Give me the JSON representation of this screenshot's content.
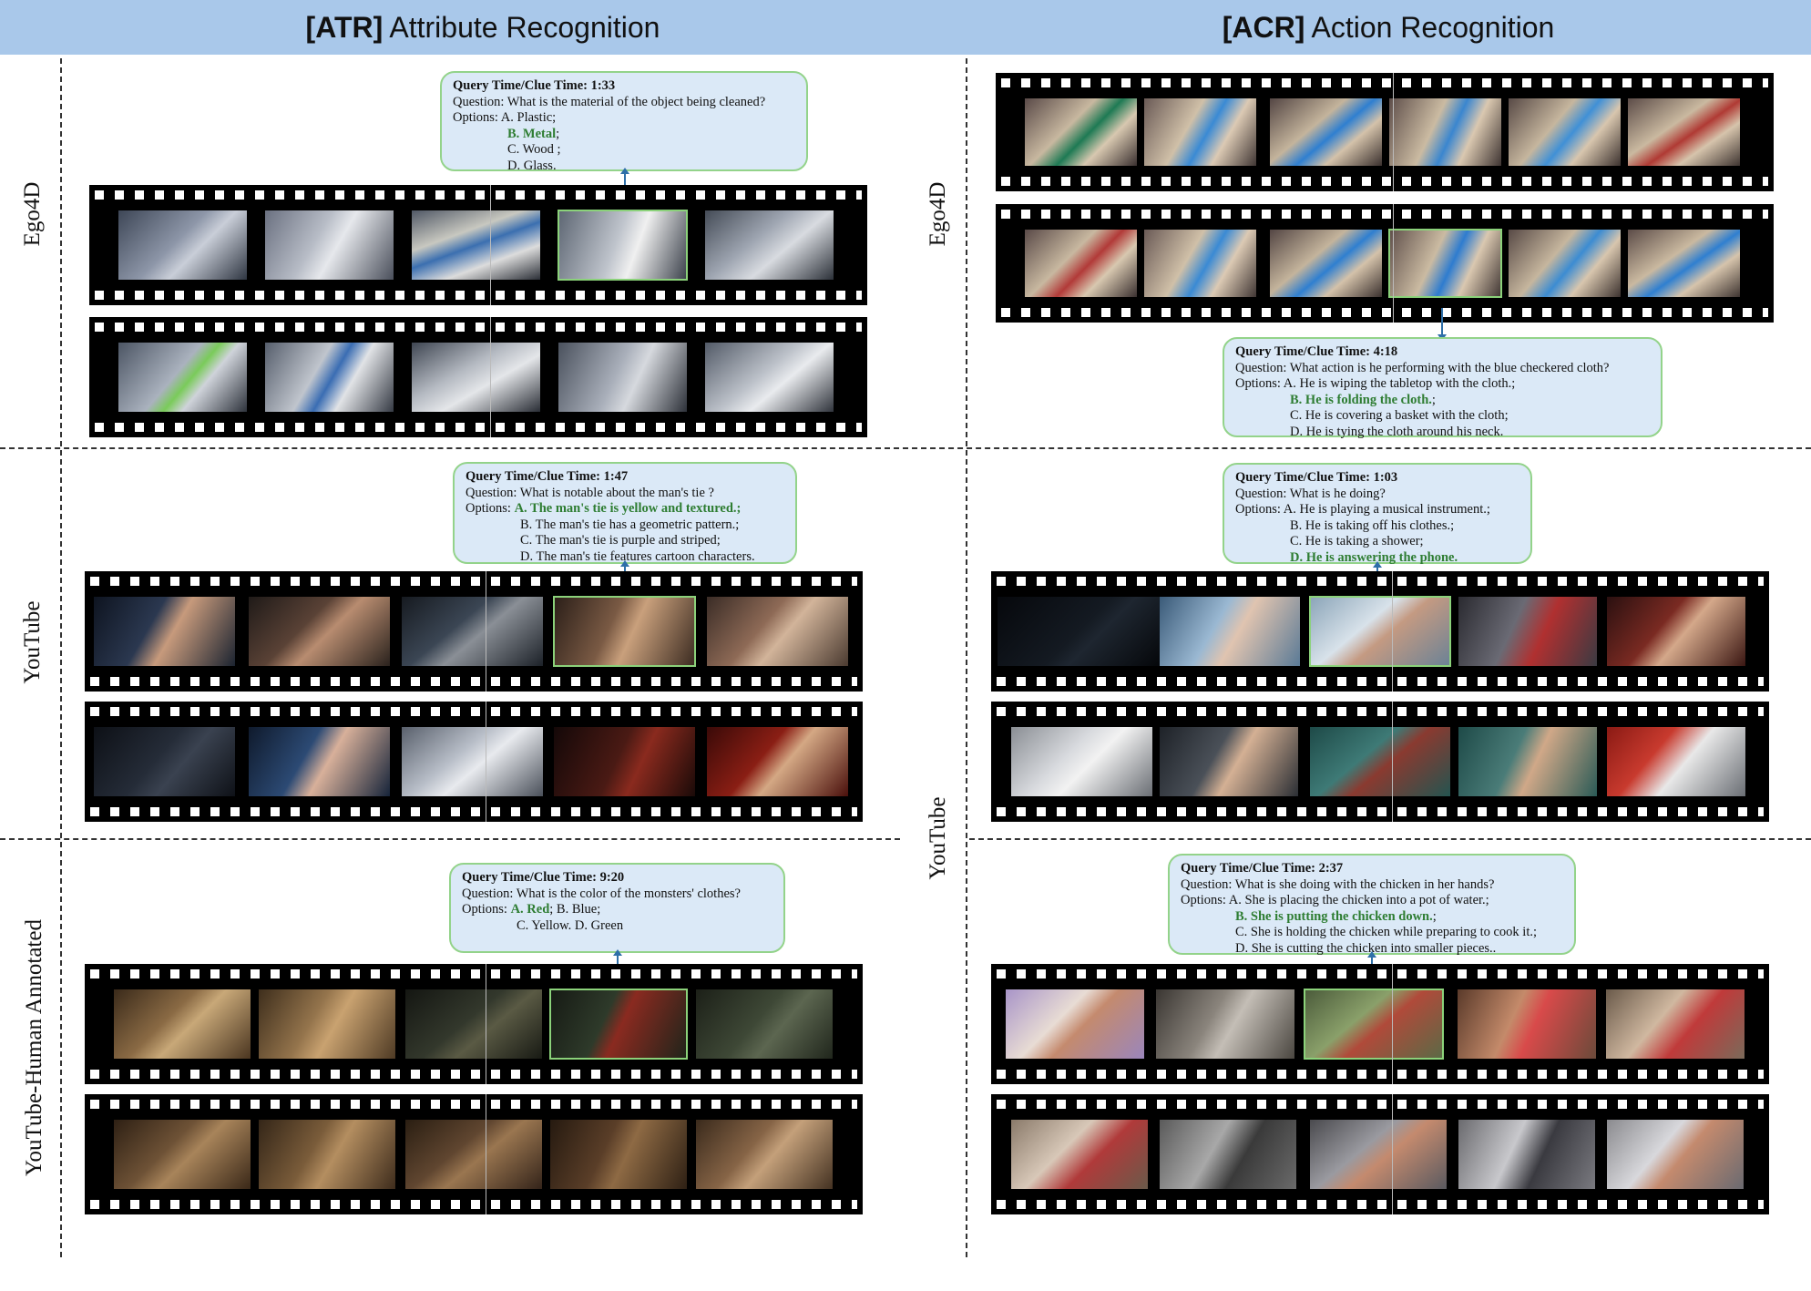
{
  "header": {
    "left": {
      "tag": "[ATR]",
      "title": "Attribute Recognition"
    },
    "right": {
      "tag": "[ACR]",
      "title": "Action Recognition"
    }
  },
  "row_labels": {
    "atr_ego4d": "Ego4D",
    "atr_youtube": "YouTube",
    "atr_human": "YouTube-Human Annotated",
    "acr_ego4d": "Ego4D",
    "acr_youtube": "YouTube"
  },
  "colors": {
    "header_bg": "#a9c8ea",
    "box_bg": "#dbe9f7",
    "box_border": "#93d38a",
    "correct_text": "#2e7d32",
    "arrow": "#2e6fa8"
  },
  "boxes": {
    "atr_ego4d": {
      "time_label": "Query Time/Clue Time: 1:33",
      "question": "Question: What is the material of the object being cleaned?",
      "opts_prefix": "Options: ",
      "opt_a": "A. Plastic;",
      "opt_b": "B. Metal",
      "opt_b_suffix": ";",
      "opt_c": "C. Wood ;",
      "opt_d": "D. Glass."
    },
    "atr_youtube": {
      "time_label": "Query Time/Clue Time: 1:47",
      "question": "Question: What is notable about the man's tie ?",
      "opts_prefix": "Options: ",
      "opt_a": "A. The man's tie is yellow and textured.;",
      "opt_b": "B. The man's tie has a geometric pattern.;",
      "opt_c": "C. The man's tie is purple and striped;",
      "opt_d": "D. The man's tie features cartoon characters."
    },
    "atr_human": {
      "time_label": "Query Time/Clue Time: 9:20",
      "question": "Question: What is the color of the monsters' clothes?",
      "opts_prefix": "Options: ",
      "opt_a": "A. Red",
      "opt_b": "; B. Blue;",
      "opt_c": "C. Yellow. D. Green"
    },
    "acr_ego4d": {
      "time_label": "Query Time/Clue Time: 4:18",
      "question": "Question: What action is he performing with the blue checkered cloth?",
      "opts_prefix": "Options: ",
      "opt_a": "A. He is wiping the tabletop with the cloth.;",
      "opt_b": "B. He is folding the cloth.",
      "opt_b_suffix": ";",
      "opt_c": "C. He is covering a basket with the cloth;",
      "opt_d": "D. He is tying the cloth around his neck."
    },
    "acr_youtube": {
      "time_label": "Query Time/Clue Time: 1:03",
      "question": "Question: What is he doing?",
      "opts_prefix": "Options: ",
      "opt_a": "A. He is playing a musical instrument.;",
      "opt_b": "B. He is taking off his clothes.;",
      "opt_c": "C. He is taking a shower;",
      "opt_d": "D. He is answering the phone."
    },
    "acr_human": {
      "time_label": "Query Time/Clue Time: 2:37",
      "question": "Question: What is she doing with the chicken in her hands?",
      "opts_prefix": "Options: ",
      "opt_a": "A. She is placing the chicken into a pot of water.;",
      "opt_b": "B. She is putting the chicken down.",
      "opt_b_suffix": ";",
      "opt_c": "C. She is holding the chicken while preparing to cook it.;",
      "opt_d": "D. She is cutting the chicken into smaller pieces.."
    }
  }
}
